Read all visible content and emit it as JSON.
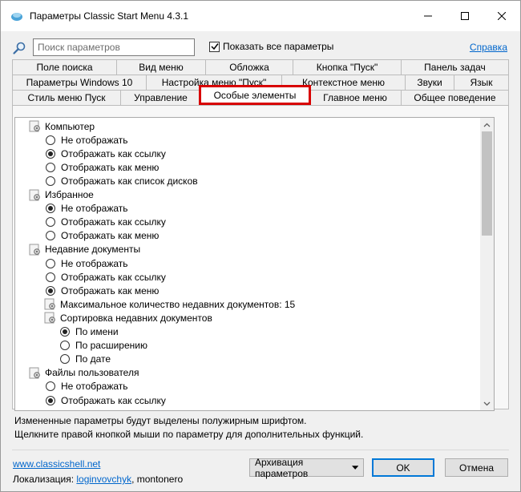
{
  "window": {
    "title": "Параметры Classic Start Menu 4.3.1"
  },
  "search": {
    "placeholder": "Поиск параметров",
    "value": ""
  },
  "show_all": {
    "label": "Показать все параметры",
    "checked": true
  },
  "help_link": "Справка",
  "tabs": {
    "row1": [
      "Поле поиска",
      "Вид меню",
      "Обложка",
      "Кнопка \"Пуск\"",
      "Панель задач"
    ],
    "row2": [
      "Параметры Windows 10",
      "Настройка меню \"Пуск\"",
      "Контекстное меню",
      "Звуки",
      "Язык"
    ],
    "row3": [
      "Стиль меню Пуск",
      "Управление",
      "Особые элементы",
      "Главное меню",
      "Общее поведение"
    ],
    "active": "Особые элементы"
  },
  "settings": [
    {
      "type": "group",
      "label": "Компьютер",
      "indent": 0
    },
    {
      "type": "radio",
      "label": "Не отображать",
      "selected": false,
      "indent": 1
    },
    {
      "type": "radio",
      "label": "Отображать как ссылку",
      "selected": true,
      "indent": 1
    },
    {
      "type": "radio",
      "label": "Отображать как меню",
      "selected": false,
      "indent": 1
    },
    {
      "type": "radio",
      "label": "Отображать как список дисков",
      "selected": false,
      "indent": 1
    },
    {
      "type": "group",
      "label": "Избранное",
      "indent": 0
    },
    {
      "type": "radio",
      "label": "Не отображать",
      "selected": true,
      "indent": 1
    },
    {
      "type": "radio",
      "label": "Отображать как ссылку",
      "selected": false,
      "indent": 1
    },
    {
      "type": "radio",
      "label": "Отображать как меню",
      "selected": false,
      "indent": 1
    },
    {
      "type": "group",
      "label": "Недавние документы",
      "indent": 0
    },
    {
      "type": "radio",
      "label": "Не отображать",
      "selected": false,
      "indent": 1
    },
    {
      "type": "radio",
      "label": "Отображать как ссылку",
      "selected": false,
      "indent": 1
    },
    {
      "type": "radio",
      "label": "Отображать как меню",
      "selected": true,
      "indent": 1
    },
    {
      "type": "setting",
      "label": "Максимальное количество недавних документов: 15",
      "indent": 1
    },
    {
      "type": "setting",
      "label": "Сортировка недавних документов",
      "indent": 1
    },
    {
      "type": "radio",
      "label": "По имени",
      "selected": true,
      "indent": 2
    },
    {
      "type": "radio",
      "label": "По расширению",
      "selected": false,
      "indent": 2
    },
    {
      "type": "radio",
      "label": "По дате",
      "selected": false,
      "indent": 2
    },
    {
      "type": "group",
      "label": "Файлы пользователя",
      "indent": 0
    },
    {
      "type": "radio",
      "label": "Не отображать",
      "selected": false,
      "indent": 1
    },
    {
      "type": "radio",
      "label": "Отображать как ссылку",
      "selected": true,
      "indent": 1
    }
  ],
  "hints": [
    "Измененные параметры будут выделены полужирным шрифтом.",
    "Щелкните правой кнопкой мыши по параметру для дополнительных функций."
  ],
  "footer": {
    "site": "www.classicshell.net",
    "localization_label": "Локализация:",
    "localizer": "loginvovchyk",
    "localizer_rest": ", montonero",
    "backup_label": "Архивация параметров",
    "ok_label": "OK",
    "cancel_label": "Отмена"
  },
  "colors": {
    "link": "#0066cc",
    "active_tab_highlight": "#d80000",
    "ok_border": "#0078d7"
  }
}
